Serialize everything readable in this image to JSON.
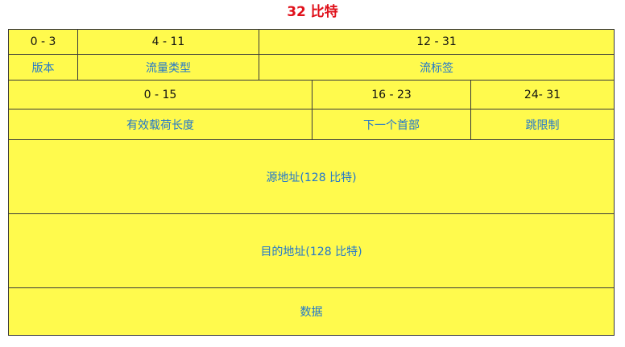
{
  "title": "32 比特",
  "colors": {
    "title": "#e0101a",
    "background": "#fffa4d",
    "border": "#3a3a3a",
    "bits_text": "#111111",
    "field_text": "#2277cc"
  },
  "rows": {
    "bits1": [
      "0 - 3",
      "4 - 11",
      "12 - 31"
    ],
    "fields1": [
      "版本",
      "流量类型",
      "流标签"
    ],
    "bits2": [
      "0 - 15",
      "16 - 23",
      "24- 31"
    ],
    "fields2": [
      "有效载荷长度",
      "下一个首部",
      "跳限制"
    ],
    "source": "源地址(128 比特)",
    "destination": "目的地址(128 比特)",
    "data": "数据"
  }
}
